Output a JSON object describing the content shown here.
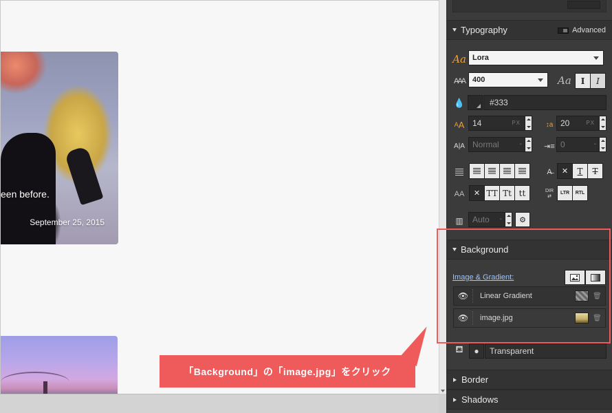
{
  "canvas": {
    "card1": {
      "excerpt": "een before.",
      "date": "September 25, 2015"
    }
  },
  "callout": {
    "text": "「Background」の「image.jpg」をクリック"
  },
  "panel": {
    "typography": {
      "title": "Typography",
      "advanced_label": "Advanced",
      "font_family": "Lora",
      "font_weight": "400",
      "italic_preview_glyph": "Aa",
      "normal_style_glyph": "I",
      "italic_style_glyph": "I",
      "color_value": "#333",
      "font_size": "14",
      "font_size_unit": "PX",
      "line_height": "20",
      "line_height_unit": "PX",
      "letter_spacing": "Normal",
      "letter_spacing_suffix": "-",
      "text_indent": "0",
      "text_indent_suffix": "-",
      "decoration_none": "✕",
      "decoration_underline": "T",
      "decoration_strike": "T",
      "case_none": "✕",
      "case_upper": "TT",
      "case_capitalize": "Tt",
      "case_lower": "tt",
      "dir_label": "DIR",
      "dir_ltr": "LTR",
      "dir_rtl": "RTL",
      "columns_value": "Auto",
      "columns_suffix": "-"
    },
    "background": {
      "title": "Background",
      "image_gradient_label": "Image & Gradient:",
      "layers": [
        {
          "name": "Linear Gradient",
          "thumb": "gradient-thumbnail"
        },
        {
          "name": "image.jpg",
          "thumb": "image-thumbnail"
        }
      ],
      "color_value": "Transparent"
    },
    "border": {
      "title": "Border"
    },
    "shadows": {
      "title": "Shadows"
    }
  }
}
